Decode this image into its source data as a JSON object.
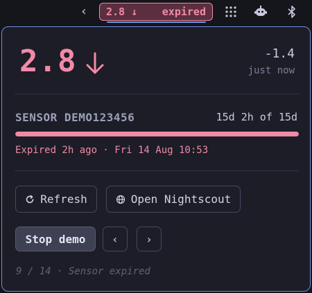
{
  "topbar": {
    "pill_value": "2.8 ↓",
    "pill_status": "expired",
    "prev_glyph": "‹",
    "icons": [
      "chevron-left-icon",
      "apps-grid-icon",
      "robot-icon",
      "bluetooth-icon"
    ]
  },
  "panel": {
    "glucose_value": "2.8",
    "trend": "down",
    "delta": "-1.4",
    "updated": "just now",
    "sensor_name": "SENSOR DEMO123456",
    "sensor_age": "15d 2h of 15d",
    "sensor_progress_fraction": 1.0,
    "expired_text": "Expired 2h ago · Fri 14 Aug 10:53",
    "refresh_label": "Refresh",
    "nightscout_label": "Open Nightscout",
    "stop_demo_label": "Stop demo",
    "prev_label": "‹",
    "next_label": "›",
    "footer_text": "9 / 14 · Sensor expired"
  },
  "colors": {
    "accent_pink": "#f08aa6",
    "panel_bg": "#1c1d26",
    "border_blue": "#6f8fdc"
  }
}
